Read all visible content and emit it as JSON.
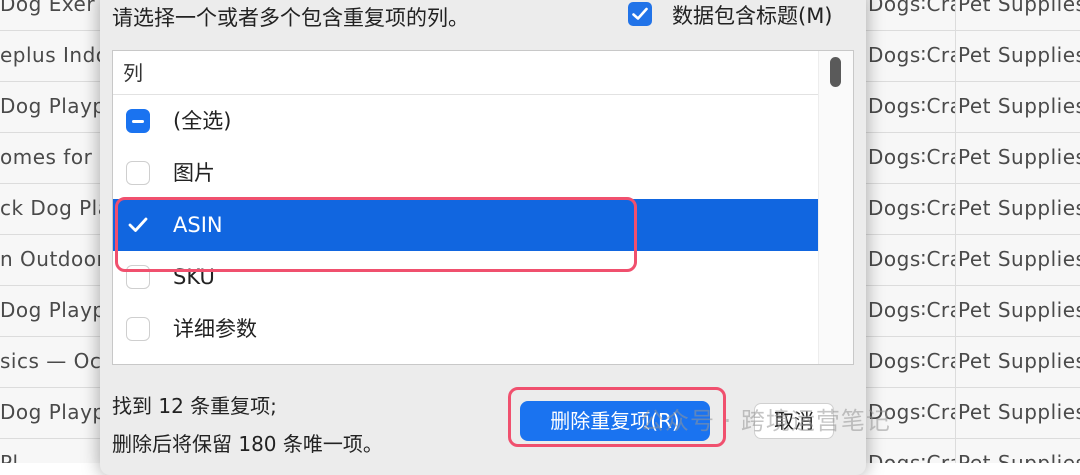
{
  "background": {
    "left_cells": [
      "Dog Exer",
      "eplus Indoo",
      "Dog Plaype",
      "omes for I",
      "ck Dog Pla",
      "n Outdoor",
      "Dog Plaype",
      "sics — Oc",
      "Dog Plaype",
      "Pl"
    ],
    "right_col1": [
      "Dogs∶Cra",
      "Dogs∶Cra",
      "Dogs∶Cra",
      "Dogs∶Cra",
      "Dogs∶Cra",
      "Dogs∶Cra",
      "Dogs∶Cra",
      "Dogs∶Cra",
      "Dogs∶Cra",
      "Dogs∶Cra"
    ],
    "right_col2": [
      "Pet Supplies",
      "Pet Supplies",
      "Pet Supplies",
      "Pet Supplies",
      "Pet Supplies",
      "Pet Supplies",
      "Pet Supplies",
      "Pet Supplies",
      "Pet Supplies",
      "Pet Supplies"
    ]
  },
  "dialog": {
    "prompt": "请选择一个或者多个包含重复项的列。",
    "header_checkbox_label": "数据包含标题(M)",
    "header_checked": true,
    "column_header": "列",
    "columns": [
      {
        "label": "(全选)",
        "state": "mixed",
        "selected": false
      },
      {
        "label": "图片",
        "state": "unchecked",
        "selected": false
      },
      {
        "label": "ASIN",
        "state": "checked",
        "selected": true
      },
      {
        "label": "SKU",
        "state": "unchecked",
        "selected": false
      },
      {
        "label": "详细参数",
        "state": "unchecked",
        "selected": false
      }
    ],
    "status_found": "找到 12 条重复项;",
    "status_keep": "删除后将保留 180 条唯一项。",
    "primary_button": "删除重复项(R)",
    "cancel_button": "取消"
  },
  "watermark": "公众号 · 跨境运营笔记",
  "colors": {
    "accent": "#1a73f0",
    "selection": "#1166e0",
    "highlight": "#f0506e"
  }
}
